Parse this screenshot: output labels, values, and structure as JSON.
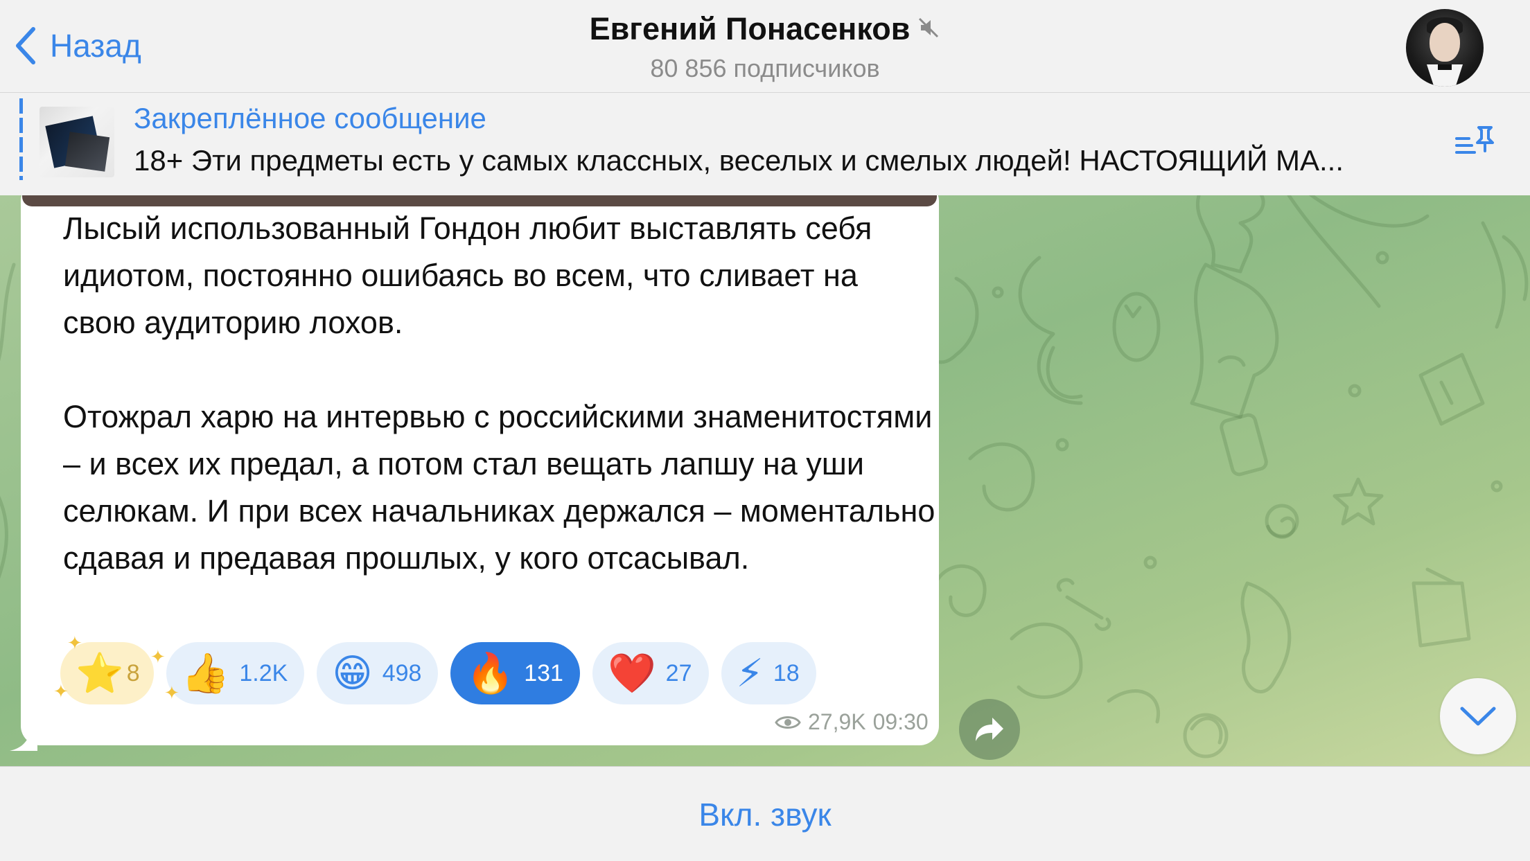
{
  "header": {
    "back_label": "Назад",
    "title": "Евгений Понасенков",
    "subtitle": "80 856 подписчиков"
  },
  "pinned": {
    "title": "Закреплённое сообщение",
    "text": "18+ Эти предметы есть у самых классных, веселых и смелых людей! НАСТОЯЩИЙ МА..."
  },
  "message": {
    "paragraph_1": "Лысый использованный Гондон любит выставлять себя идиотом, постоянно ошибаясь во всем, что сливает на свою аудиторию лохов.",
    "paragraph_2": "Отожрал харю на интервью с российскими знаменитостями – и всех их предал, а потом стал вещать лапшу на уши селюкам. И при всех начальниках держался – моментально сдавая и предавая прошлых, у кого отсасывал.",
    "views": "27,9K",
    "time": "09:30"
  },
  "reactions": [
    {
      "emoji": "⭐",
      "count": "8"
    },
    {
      "emoji": "👍",
      "count": "1.2K"
    },
    {
      "emoji": "😁",
      "count": "498"
    },
    {
      "emoji": "🔥",
      "count": "131"
    },
    {
      "emoji": "❤️",
      "count": "27"
    },
    {
      "emoji": "⚡",
      "count": "18"
    }
  ],
  "bottom": {
    "action_label": "Вкл. звук"
  },
  "colors": {
    "accent": "#3a86e8",
    "active_reaction": "#2f7de1",
    "chat_bg": "#9cc28e"
  }
}
